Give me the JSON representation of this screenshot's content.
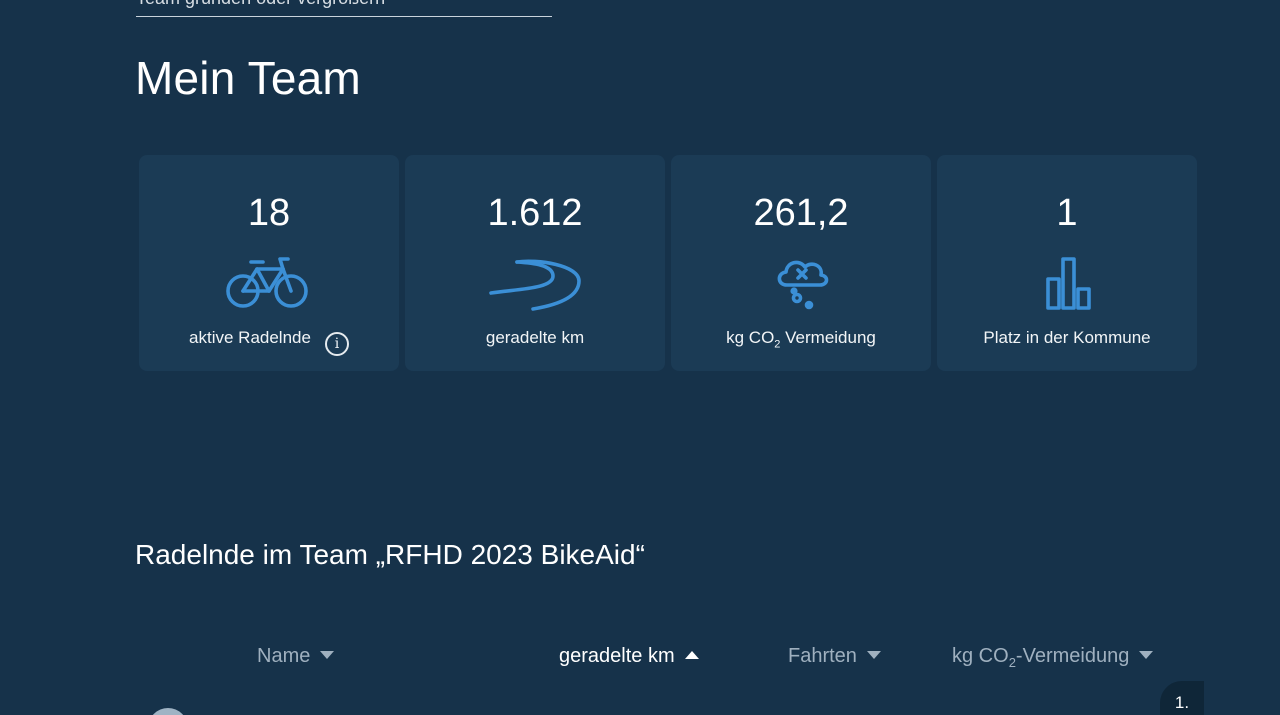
{
  "top_link": {
    "label": "Team gründen oder vergrößern"
  },
  "page_title": "Mein Team",
  "stats": [
    {
      "value": "18",
      "label": "aktive Radelnde",
      "icon": "bicycle-icon",
      "has_info": true
    },
    {
      "value": "1.612",
      "label": "geradelte km",
      "icon": "road-icon"
    },
    {
      "value": "261,2",
      "label_pre": "kg CO",
      "label_sub": "2",
      "label_post": " Vermeidung",
      "icon": "cloud-co2-icon"
    },
    {
      "value": "1",
      "label": "Platz in der Kommune",
      "icon": "bar-chart-icon"
    }
  ],
  "section_title": "Radelnde im Team „RFHD 2023 BikeAid“",
  "table": {
    "columns": [
      {
        "label": "Name",
        "sort": "down"
      },
      {
        "label": "geradelte km",
        "sort": "up",
        "active": true
      },
      {
        "label": "Fahrten",
        "sort": "down"
      },
      {
        "label_pre": "kg CO",
        "label_sub": "2",
        "label_post": "-Vermeidung",
        "sort": "down"
      }
    ],
    "first_rank": "1."
  },
  "colors": {
    "background": "#16324a",
    "card": "#1b3b55",
    "icon_blue": "#3b8fd6",
    "muted_text": "#9fb0bf"
  }
}
